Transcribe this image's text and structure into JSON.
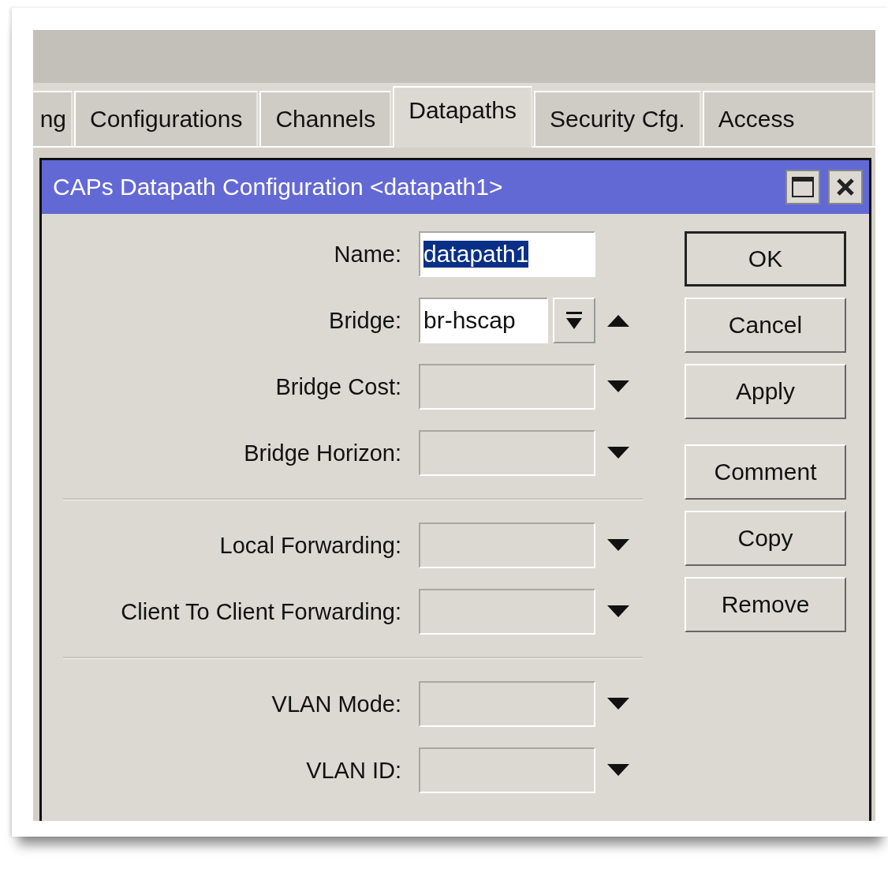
{
  "tabs": [
    {
      "label": "ng",
      "selected": false
    },
    {
      "label": "Configurations",
      "selected": false
    },
    {
      "label": "Channels",
      "selected": false
    },
    {
      "label": "Datapaths",
      "selected": true
    },
    {
      "label": "Security Cfg.",
      "selected": false
    },
    {
      "label": "Access",
      "selected": false
    }
  ],
  "dialog": {
    "title": "CAPs Datapath Configuration <datapath1>",
    "groups": [
      [
        {
          "label": "Name:",
          "kind": "text",
          "value": "datapath1",
          "text_selected": true
        },
        {
          "label": "Bridge:",
          "kind": "combo",
          "value": "br-hscap",
          "expanded": true
        },
        {
          "label": "Bridge Cost:",
          "kind": "empty",
          "expanded": false
        },
        {
          "label": "Bridge Horizon:",
          "kind": "empty",
          "expanded": false
        }
      ],
      [
        {
          "label": "Local Forwarding:",
          "kind": "empty",
          "expanded": false
        },
        {
          "label": "Client To Client Forwarding:",
          "kind": "empty",
          "expanded": false
        }
      ],
      [
        {
          "label": "VLAN Mode:",
          "kind": "empty",
          "expanded": false
        },
        {
          "label": "VLAN ID:",
          "kind": "empty",
          "expanded": false
        }
      ]
    ],
    "buttons": [
      {
        "label": "OK",
        "default": true
      },
      {
        "label": "Cancel",
        "default": false
      },
      {
        "label": "Apply",
        "default": false
      },
      {
        "label": "Comment",
        "default": false
      },
      {
        "label": "Copy",
        "default": false
      },
      {
        "label": "Remove",
        "default": false
      }
    ]
  }
}
